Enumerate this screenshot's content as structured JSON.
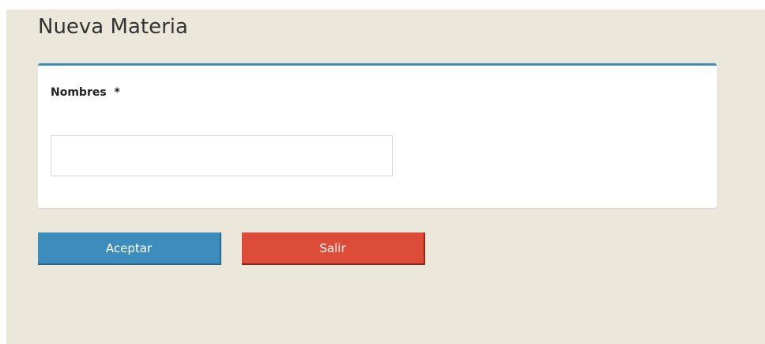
{
  "page": {
    "title": "Nueva Materia"
  },
  "form": {
    "name_label": "Nombres",
    "required_marker": "*",
    "name_value": "",
    "name_placeholder": ""
  },
  "actions": {
    "accept_label": "Aceptar",
    "exit_label": "Salir"
  },
  "colors": {
    "background": "#ebe7da",
    "card_border": "#3c8dbc",
    "accept_button": "#3c8dbc",
    "exit_button": "#dd4b39"
  }
}
